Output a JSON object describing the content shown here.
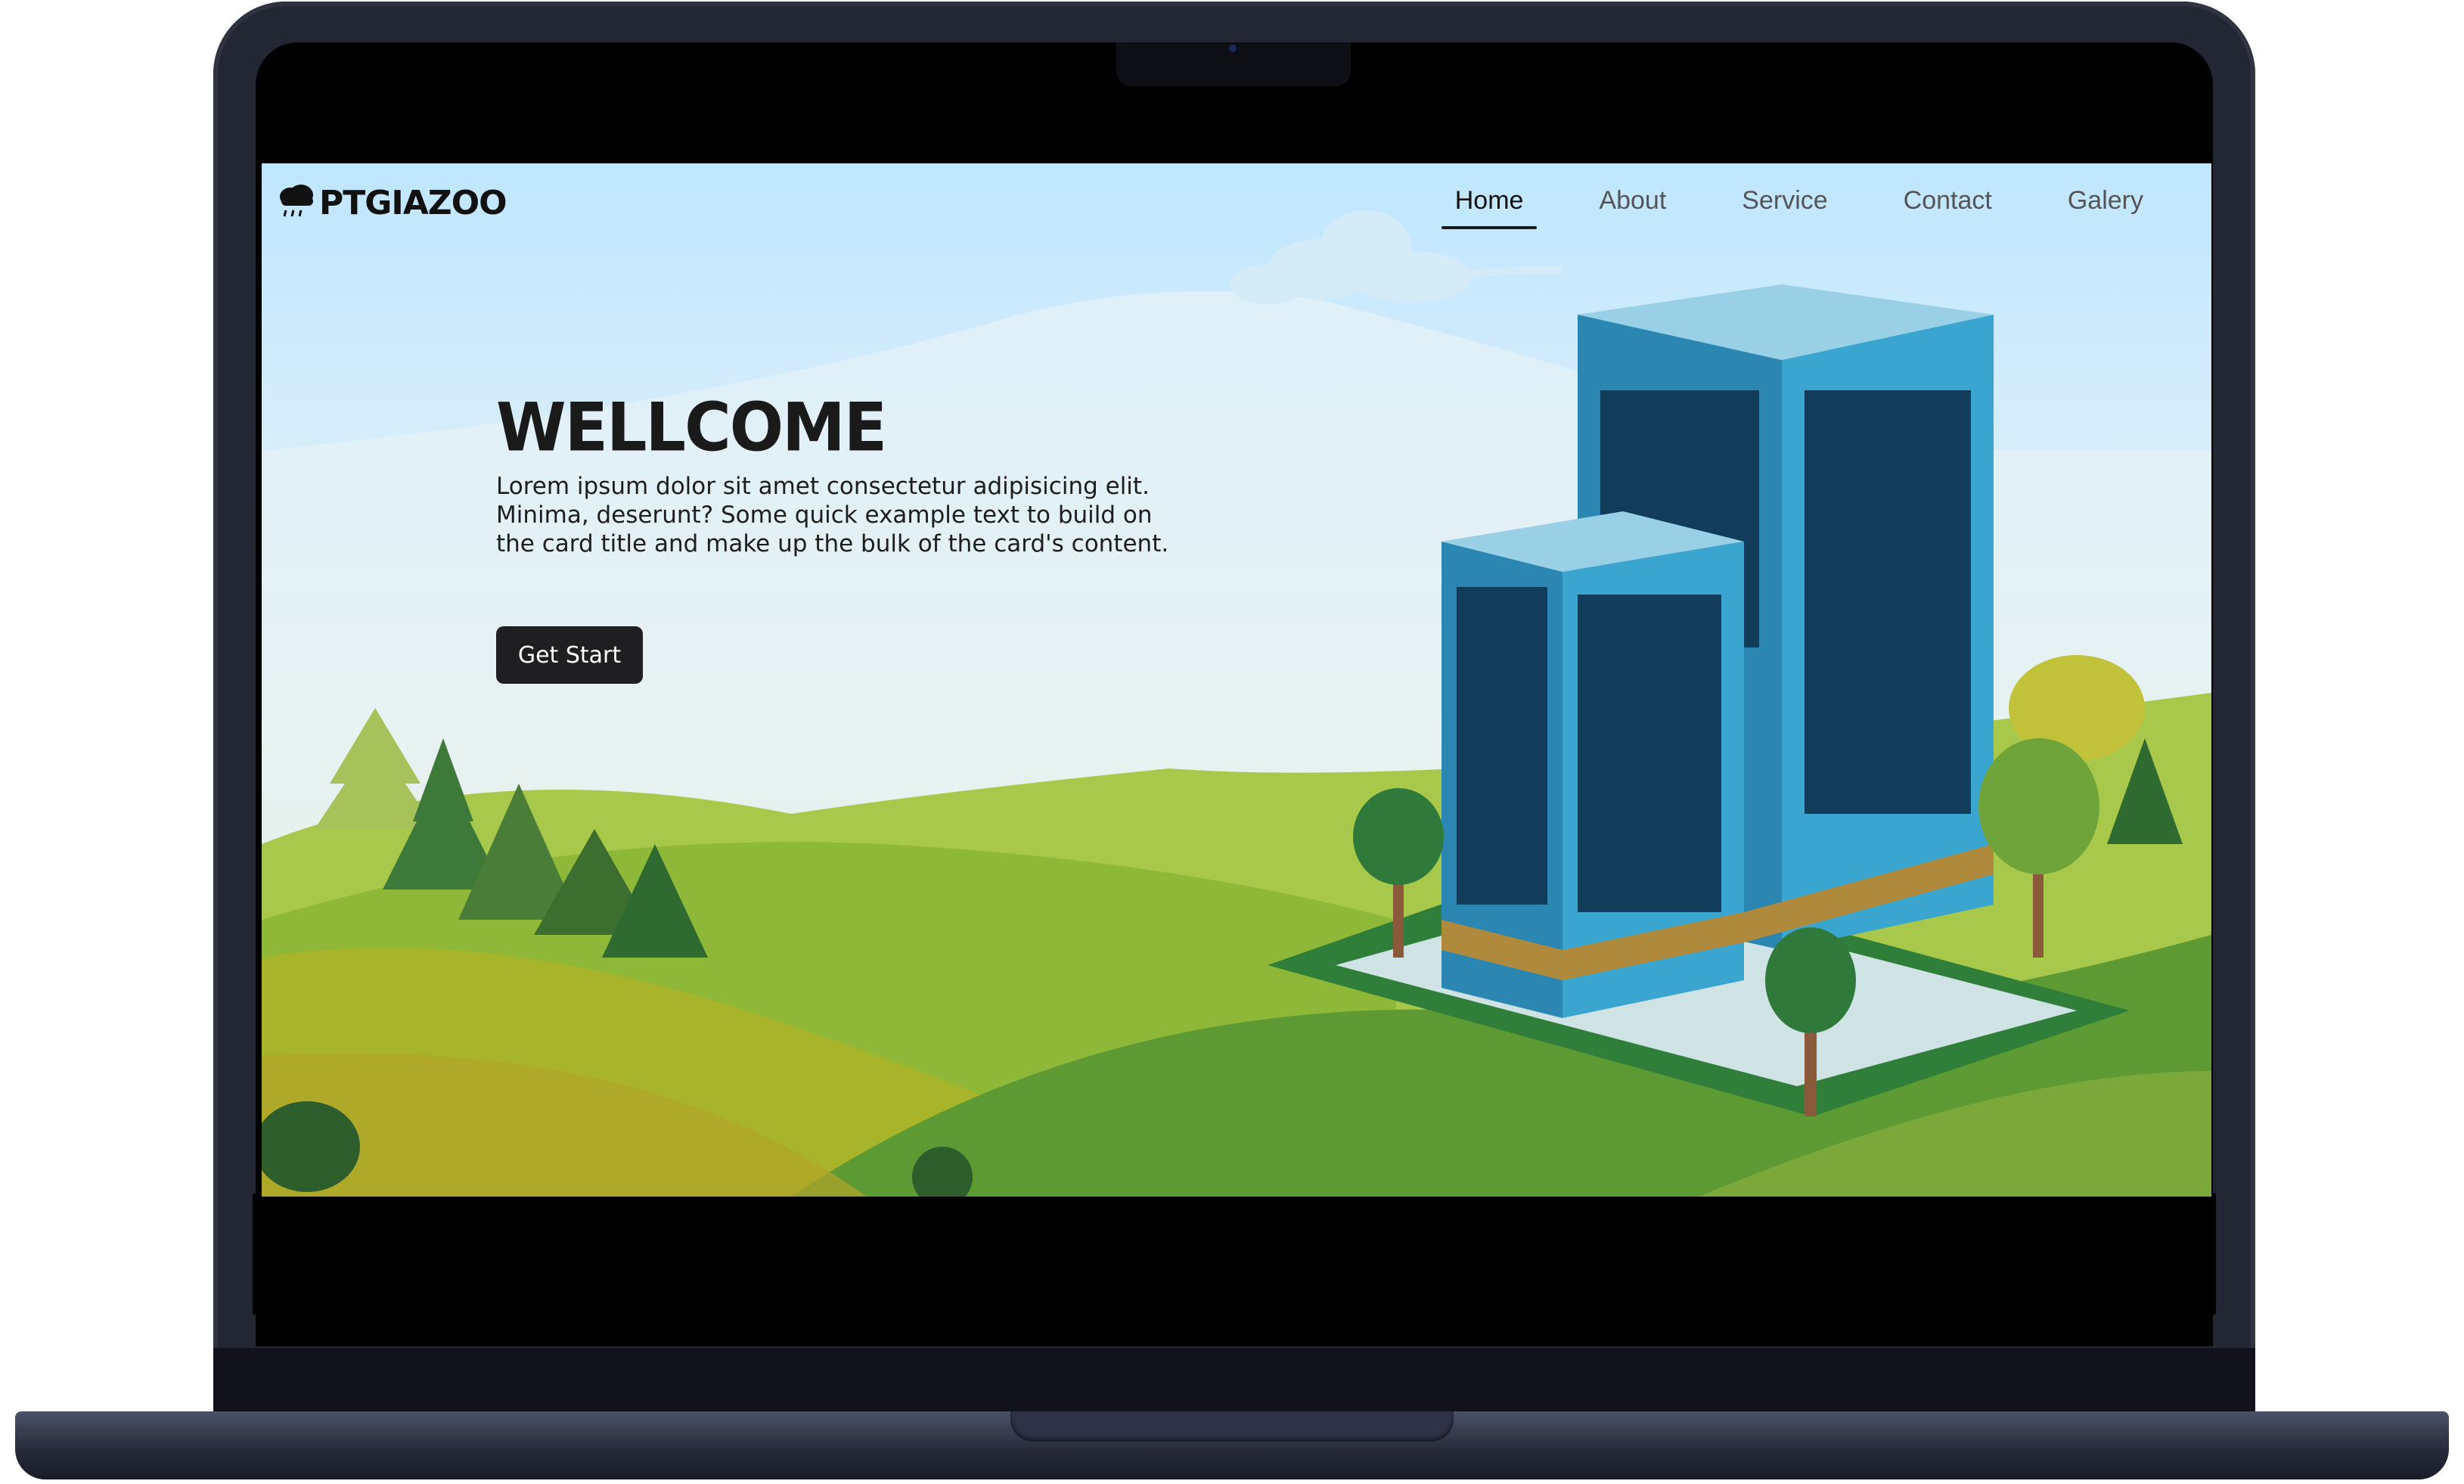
{
  "brand": {
    "name": "PTGIAZOO",
    "icon": "cloud-rain-icon"
  },
  "nav": {
    "items": [
      {
        "label": "Home",
        "active": true
      },
      {
        "label": "About",
        "active": false
      },
      {
        "label": "Service",
        "active": false
      },
      {
        "label": "Contact",
        "active": false
      },
      {
        "label": "Galery",
        "active": false
      }
    ]
  },
  "hero": {
    "title": "WELLCOME",
    "text": "Lorem ipsum dolor sit amet consectetur adipisicing elit. Minima, deserunt? Some quick example text to build on the card title and make up the bulk of the card's content.",
    "button_label": "Get Start"
  },
  "colors": {
    "button_bg": "#1f1f22",
    "sky_top": "#bfe6ff",
    "hill_green": "#7fb23a",
    "building_blue": "#3a9cc4"
  }
}
